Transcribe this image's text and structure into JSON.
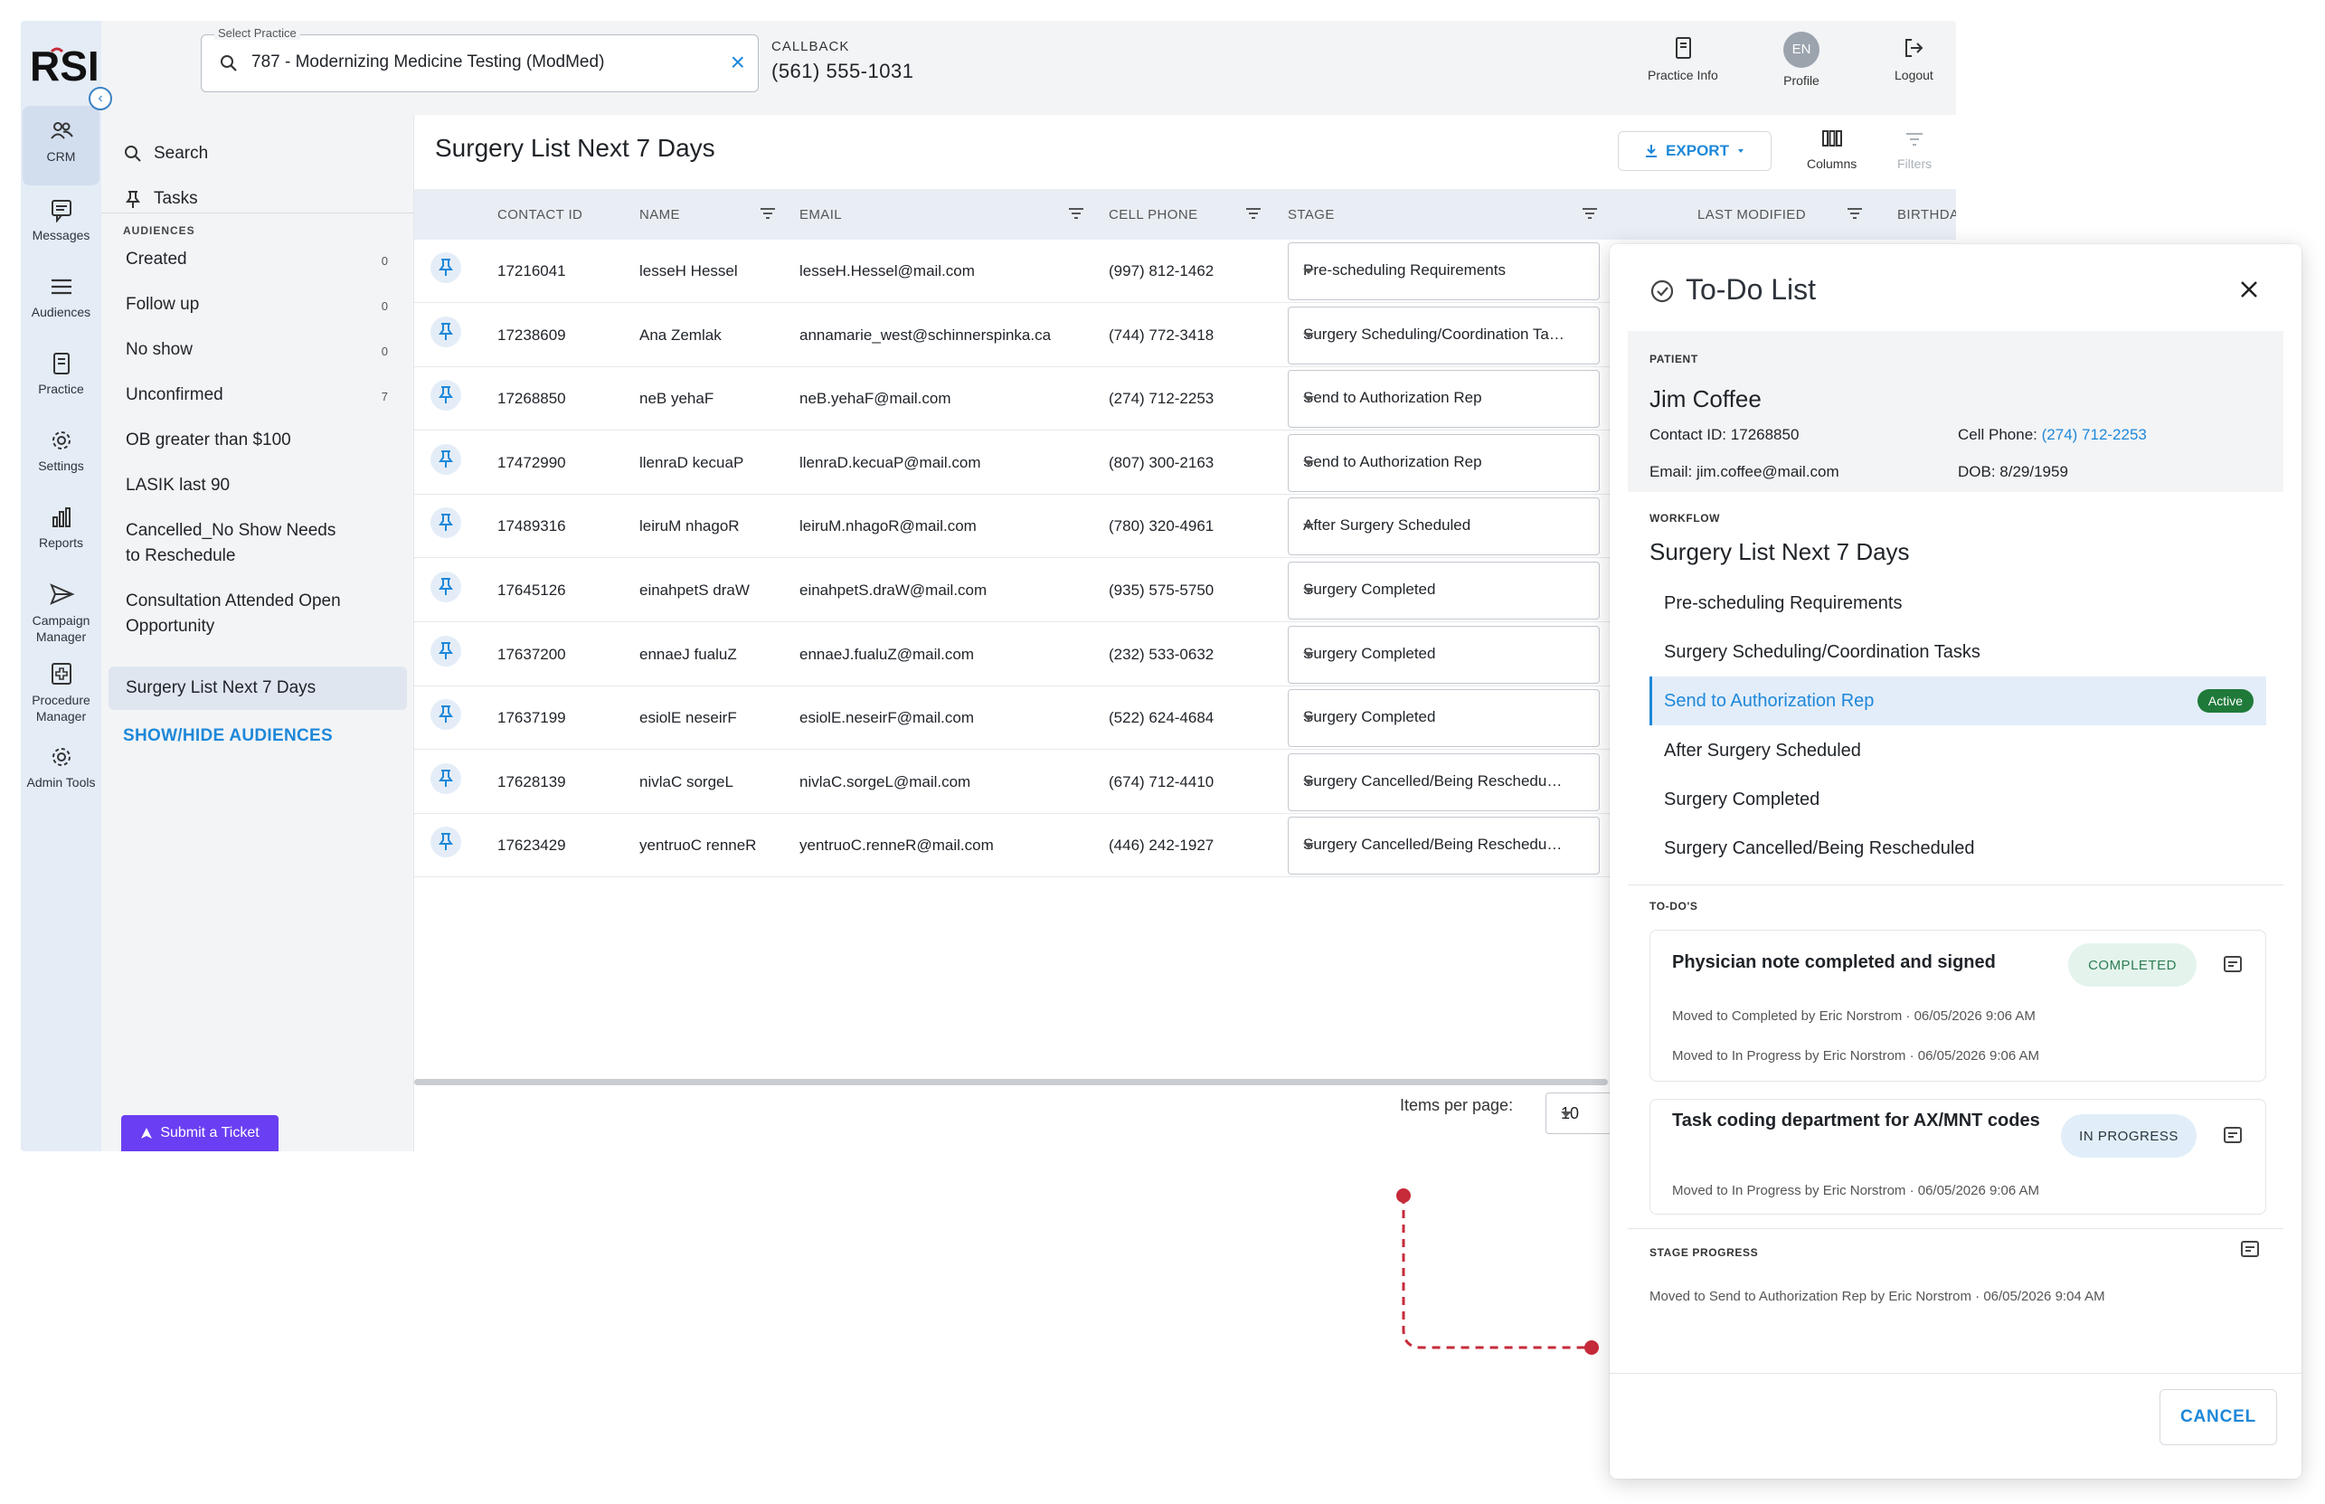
{
  "brand": {
    "logo_text": "RSI"
  },
  "rail": {
    "items": [
      {
        "label": "CRM",
        "icon": "people-icon"
      },
      {
        "label": "Messages",
        "icon": "message-icon"
      },
      {
        "label": "Audiences",
        "icon": "list-icon"
      },
      {
        "label": "Practice",
        "icon": "clipboard-icon"
      },
      {
        "label": "Settings",
        "icon": "gear-icon"
      },
      {
        "label": "Reports",
        "icon": "bar-chart-icon"
      },
      {
        "label": "Campaign Manager",
        "icon": "send-icon"
      },
      {
        "label": "Procedure Manager",
        "icon": "medical-cross-icon"
      },
      {
        "label": "Admin Tools",
        "icon": "gear-icon"
      }
    ]
  },
  "topbar": {
    "practice_label": "Select Practice",
    "practice_value": "787 - Modernizing Medicine Testing (ModMed)",
    "callback_label": "CALLBACK",
    "callback_number": "(561) 555-1031",
    "practice_info": "Practice Info",
    "profile": "Profile",
    "profile_initials": "EN",
    "logout": "Logout"
  },
  "sidebar": {
    "search": "Search",
    "tasks": "Tasks",
    "audiences_label": "AUDIENCES",
    "audiences": [
      {
        "label": "Created",
        "count": "0"
      },
      {
        "label": "Follow up",
        "count": "0"
      },
      {
        "label": "No show",
        "count": "0"
      },
      {
        "label": "Unconfirmed",
        "count": "7"
      },
      {
        "label": "OB greater than $100",
        "count": ""
      },
      {
        "label": "LASIK last 90",
        "count": ""
      },
      {
        "label": "Cancelled_No Show Needs to Reschedule",
        "count": ""
      },
      {
        "label": "Consultation Attended Open Opportunity",
        "count": ""
      },
      {
        "label": "Surgery List Next 7 Days",
        "count": ""
      }
    ],
    "show_hide": "SHOW/HIDE AUDIENCES",
    "submit_ticket": "Submit a Ticket"
  },
  "main": {
    "title": "Surgery List Next 7 Days",
    "export": "EXPORT",
    "columns": "Columns",
    "filters": "Filters",
    "headers": {
      "contact_id": "CONTACT ID",
      "name": "NAME",
      "email": "EMAIL",
      "cell_phone": "CELL PHONE",
      "stage": "STAGE",
      "last_modified": "LAST MODIFIED",
      "birthday": "BIRTHDA"
    },
    "rows": [
      {
        "id": "17216041",
        "name": "lesseH Hessel",
        "email": "lesseH.Hessel@mail.com",
        "phone": "(997) 812-1462",
        "stage": "Pre-scheduling Requirements"
      },
      {
        "id": "17238609",
        "name": "Ana Zemlak",
        "email": "annamarie_west@schinnerspinka.ca",
        "phone": "(744) 772-3418",
        "stage": "Surgery Scheduling/Coordination Tasks"
      },
      {
        "id": "17268850",
        "name": "neB yehaF",
        "email": "neB.yehaF@mail.com",
        "phone": "(274) 712-2253",
        "stage": "Send to Authorization Rep"
      },
      {
        "id": "17472990",
        "name": "llenraD kecuaP",
        "email": "llenraD.kecuaP@mail.com",
        "phone": "(807) 300-2163",
        "stage": "Send to Authorization Rep"
      },
      {
        "id": "17489316",
        "name": "leiruM nhagoR",
        "email": "leiruM.nhagoR@mail.com",
        "phone": "(780) 320-4961",
        "stage": "After Surgery Scheduled"
      },
      {
        "id": "17645126",
        "name": "einahpetS draW",
        "email": "einahpetS.draW@mail.com",
        "phone": "(935) 575-5750",
        "stage": "Surgery Completed"
      },
      {
        "id": "17637200",
        "name": "ennaeJ fualuZ",
        "email": "ennaeJ.fualuZ@mail.com",
        "phone": "(232) 533-0632",
        "stage": "Surgery Completed"
      },
      {
        "id": "17637199",
        "name": "esiolE neseirF",
        "email": "esiolE.neseirF@mail.com",
        "phone": "(522) 624-4684",
        "stage": "Surgery Completed"
      },
      {
        "id": "17628139",
        "name": "nivlaC sorgeL",
        "email": "nivlaC.sorgeL@mail.com",
        "phone": "(674) 712-4410",
        "stage": "Surgery Cancelled/Being Rescheduled"
      },
      {
        "id": "17623429",
        "name": "yentruoC renneR",
        "email": "yentruoC.renneR@mail.com",
        "phone": "(446) 242-1927",
        "stage": "Surgery Cancelled/Being Rescheduled"
      }
    ],
    "items_per_page_label": "Items per page:",
    "items_per_page_value": "10"
  },
  "panel": {
    "title": "To-Do List",
    "patient_label": "PATIENT",
    "patient_name": "Jim Coffee",
    "contact_id_label": "Contact ID:",
    "contact_id": "17268850",
    "cell_label": "Cell Phone:",
    "cell": "(274) 712-2253",
    "email_label": "Email:",
    "email": "jim.coffee@mail.com",
    "dob_label": "DOB:",
    "dob": "8/29/1959",
    "workflow_label": "WORKFLOW",
    "workflow_title": "Surgery List Next 7 Days",
    "workflow_steps": [
      "Pre-scheduling Requirements",
      "Surgery Scheduling/Coordination Tasks",
      "Send to Authorization Rep",
      "After Surgery Scheduled",
      "Surgery Completed",
      "Surgery Cancelled/Being Rescheduled"
    ],
    "active_badge": "Active",
    "todos_label": "TO-DO'S",
    "todos": [
      {
        "title": "Physician note completed and signed",
        "status": "COMPLETED",
        "meta": [
          "Moved to Completed by Eric Norstrom · 06/05/2026 9:06 AM",
          "Moved to In Progress by Eric Norstrom · 06/05/2026 9:06 AM"
        ]
      },
      {
        "title": "Task coding department for AX/MNT codes",
        "status": "IN PROGRESS",
        "meta": [
          "Moved to In Progress by Eric Norstrom · 06/05/2026 9:06 AM"
        ]
      }
    ],
    "stage_progress_label": "STAGE PROGRESS",
    "stage_progress_meta": "Moved to Send to Authorization Rep by Eric Norstrom · 06/05/2026 9:04 AM",
    "cancel": "CANCEL"
  },
  "colors": {
    "accent": "#1e88d9",
    "active_green": "#1f7a3a",
    "ticket_purple": "#6a3ef3",
    "connector_red": "#c62b3a"
  }
}
